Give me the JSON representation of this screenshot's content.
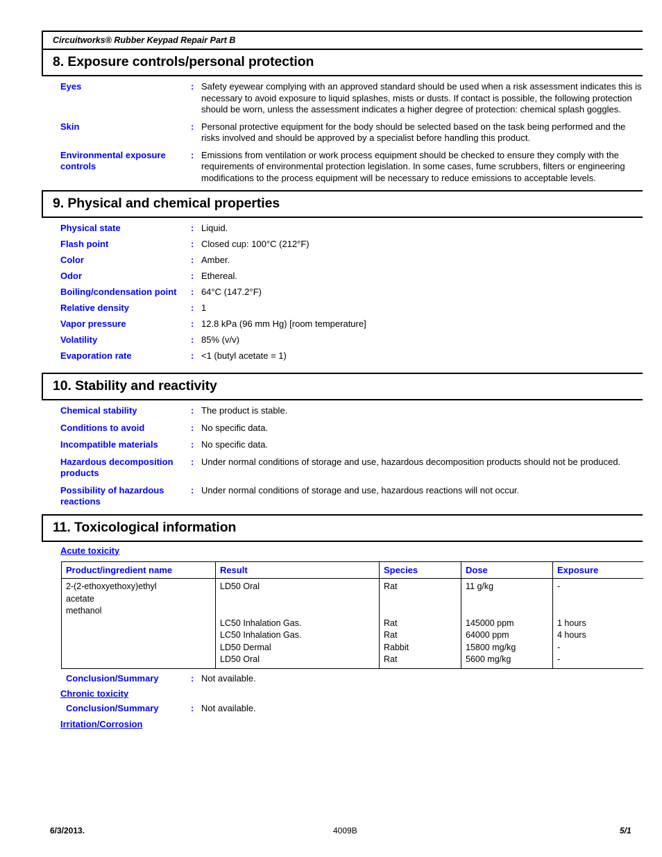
{
  "document": {
    "product_title": "Circuitworks® Rubber Keypad Repair Part B"
  },
  "sections": {
    "exposure": {
      "heading": "8. Exposure controls/personal protection",
      "rows": [
        {
          "label": "Eyes",
          "colon": ":",
          "value": "Safety eyewear complying with an approved standard should be used when a risk assessment indicates this is necessary to avoid exposure to liquid splashes, mists or dusts.  If contact is possible, the following protection should be worn, unless the assessment indicates a higher degree of protection:  chemical splash goggles."
        },
        {
          "label": "Skin",
          "colon": ":",
          "value": "Personal protective equipment for the body should be selected based on the task being performed and the risks involved and should be approved by a specialist before handling this product."
        },
        {
          "label": "Environmental exposure controls",
          "colon": ":",
          "value": "Emissions from ventilation or work process equipment should be checked to ensure they comply with the requirements of environmental protection legislation.  In some cases, fume scrubbers, filters or engineering modifications to the process equipment will be necessary to reduce emissions to acceptable levels."
        }
      ]
    },
    "physical": {
      "heading": "9. Physical and chemical properties",
      "rows": [
        {
          "label": "Physical state",
          "colon": ":",
          "value": "Liquid."
        },
        {
          "label": "Flash point",
          "colon": ":",
          "value": "Closed cup: 100°C (212°F)"
        },
        {
          "label": "Color",
          "colon": ":",
          "value": "Amber."
        },
        {
          "label": "Odor",
          "colon": ":",
          "value": "Ethereal."
        },
        {
          "label": "Boiling/condensation point",
          "colon": ":",
          "value": "64°C (147.2°F)"
        },
        {
          "label": "Relative density",
          "colon": ":",
          "value": "1"
        },
        {
          "label": "Vapor pressure",
          "colon": ":",
          "value": "12.8 kPa (96 mm Hg) [room temperature]"
        },
        {
          "label": "Volatility",
          "colon": ":",
          "value": "85% (v/v)"
        },
        {
          "label": "Evaporation rate",
          "colon": ":",
          "value": "<1 (butyl acetate = 1)"
        }
      ]
    },
    "stability": {
      "heading": "10. Stability and reactivity",
      "rows": [
        {
          "label": "Chemical stability",
          "colon": ":",
          "value": "The product is stable."
        },
        {
          "label": "Conditions to avoid",
          "colon": ":",
          "value": "No specific data."
        },
        {
          "label": "Incompatible materials",
          "colon": ":",
          "value": "No specific data."
        },
        {
          "label": "Hazardous decomposition products",
          "colon": ":",
          "value": "Under normal conditions of storage and use, hazardous decomposition products should not be produced."
        },
        {
          "label": "Possibility of hazardous reactions",
          "colon": ":",
          "value": "Under normal conditions of storage and use, hazardous reactions will not occur."
        }
      ]
    },
    "toxicological": {
      "heading": "11. Toxicological information",
      "acute_toxicity_label": "Acute toxicity",
      "table": {
        "columns": [
          "Product/ingredient name",
          "Result",
          "Species",
          "Dose",
          "Exposure"
        ],
        "cells": {
          "name": "2-(2-ethoxyethoxy)ethyl\nacetate\nmethanol",
          "result": "LD50 Oral\n\nLC50 Inhalation Gas.\nLC50 Inhalation Gas.\nLD50 Dermal\nLD50 Oral",
          "species": "Rat\n\nRat\nRat\nRabbit\nRat",
          "dose": "11 g/kg\n\n145000 ppm\n64000 ppm\n15800 mg/kg\n5600 mg/kg",
          "exposure": "-\n\n1 hours\n4 hours\n-\n-"
        }
      },
      "acute_conclusion": {
        "label": "Conclusion/Summary",
        "colon": ":",
        "value": "Not available."
      },
      "chronic_toxicity_label": "Chronic toxicity",
      "chronic_conclusion": {
        "label": "Conclusion/Summary",
        "colon": ":",
        "value": "Not available."
      },
      "irritation_label": "Irritation/Corrosion"
    }
  },
  "footer": {
    "date": "6/3/2013.",
    "code": "4009B",
    "page": "5/1"
  }
}
